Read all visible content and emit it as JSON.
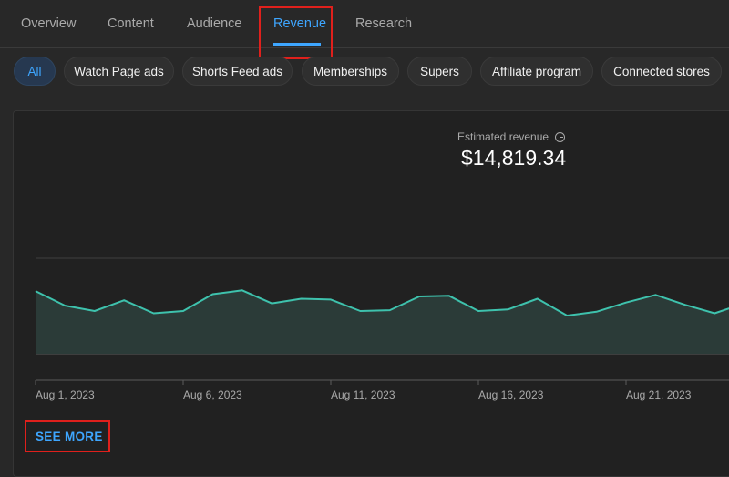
{
  "tabs": [
    {
      "label": "Overview"
    },
    {
      "label": "Content"
    },
    {
      "label": "Audience"
    },
    {
      "label": "Revenue",
      "active": true
    },
    {
      "label": "Research"
    }
  ],
  "chips": [
    {
      "label": "All",
      "active": true
    },
    {
      "label": "Watch Page ads"
    },
    {
      "label": "Shorts Feed ads"
    },
    {
      "label": "Memberships"
    },
    {
      "label": "Supers"
    },
    {
      "label": "Affiliate program"
    },
    {
      "label": "Connected stores"
    }
  ],
  "metric": {
    "label": "Estimated revenue",
    "value": "$14,819.34",
    "info_icon": "clock-icon"
  },
  "chart_data": {
    "type": "area",
    "x_tick_labels": [
      "Aug 1, 2023",
      "Aug 6, 2023",
      "Aug 11, 2023",
      "Aug 16, 2023",
      "Aug 21, 2023"
    ],
    "x": [
      "Aug 1",
      "Aug 2",
      "Aug 3",
      "Aug 4",
      "Aug 5",
      "Aug 6",
      "Aug 7",
      "Aug 8",
      "Aug 9",
      "Aug 10",
      "Aug 11",
      "Aug 12",
      "Aug 13",
      "Aug 14",
      "Aug 15",
      "Aug 16",
      "Aug 17",
      "Aug 18",
      "Aug 19",
      "Aug 20",
      "Aug 21",
      "Aug 22",
      "Aug 23",
      "Aug 24",
      "Aug 25"
    ],
    "values": [
      0.82,
      0.63,
      0.56,
      0.7,
      0.53,
      0.56,
      0.78,
      0.83,
      0.66,
      0.72,
      0.71,
      0.56,
      0.57,
      0.75,
      0.76,
      0.56,
      0.58,
      0.72,
      0.5,
      0.55,
      0.67,
      0.77,
      0.64,
      0.53,
      0.66
    ],
    "ylim": [
      0,
      1.25
    ],
    "y_gridlines": [
      0,
      0.625,
      1.25
    ],
    "line_color": "#3ec2ad",
    "fill_color": "#2b3b38",
    "grid": true
  },
  "see_more_label": "SEE MORE"
}
